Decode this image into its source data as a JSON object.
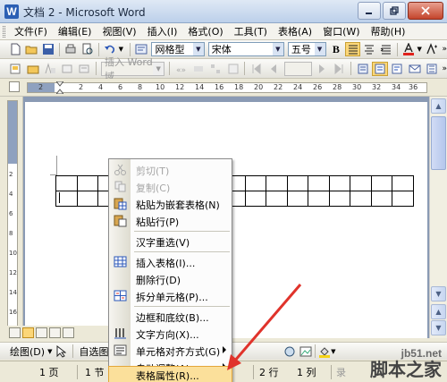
{
  "window": {
    "title": "文档 2 - Microsoft Word",
    "app_icon": "W"
  },
  "menu": [
    "文件(F)",
    "编辑(E)",
    "视图(V)",
    "插入(I)",
    "格式(O)",
    "工具(T)",
    "表格(A)",
    "窗口(W)",
    "帮助(H)"
  ],
  "toolbar": {
    "style_value": "网格型",
    "font_value": "宋体",
    "size_value": "五号",
    "bold_label": "B",
    "insert_word_label": "插入 Word 域"
  },
  "ruler": {
    "numbers": [
      "2",
      "2",
      "4",
      "6",
      "8",
      "10",
      "12",
      "14",
      "16",
      "18",
      "20",
      "22",
      "24",
      "26",
      "28",
      "30",
      "32",
      "34",
      "36",
      "38"
    ],
    "vertical_numbers": [
      "2",
      "4",
      "6",
      "8",
      "10",
      "12",
      "14",
      "16",
      "18",
      "20"
    ]
  },
  "context_menu": {
    "items": [
      {
        "label": "剪切(T)",
        "disabled": true,
        "icon": "scissors-icon"
      },
      {
        "label": "复制(C)",
        "disabled": true,
        "icon": "copy-icon"
      },
      {
        "label": "粘贴为嵌套表格(N)",
        "disabled": false,
        "icon": "paste-nested-icon"
      },
      {
        "label": "粘贴行(P)",
        "disabled": false,
        "icon": "paste-icon"
      },
      {
        "label": "汉字重选(V)",
        "disabled": false,
        "icon": ""
      },
      {
        "label": "插入表格(I)...",
        "disabled": false,
        "icon": "insert-table-icon"
      },
      {
        "label": "删除行(D)",
        "disabled": false,
        "icon": ""
      },
      {
        "label": "拆分单元格(P)...",
        "disabled": false,
        "icon": "split-cells-icon"
      },
      {
        "label": "边框和底纹(B)...",
        "disabled": false,
        "icon": ""
      },
      {
        "label": "文字方向(X)...",
        "disabled": false,
        "icon": "text-direction-icon"
      },
      {
        "label": "单元格对齐方式(G)",
        "disabled": false,
        "icon": "cell-align-icon",
        "submenu": true
      },
      {
        "label": "自动调整(A)",
        "disabled": false,
        "icon": "",
        "submenu": true
      },
      {
        "label": "表格属性(R)...",
        "disabled": false,
        "icon": "",
        "highlighted": true
      }
    ]
  },
  "drawing_toolbar": {
    "draw_label": "绘图(D)",
    "autoshapes_label": "自选图形(U)"
  },
  "status": {
    "page": "1 页",
    "section": "1 节",
    "line": "2 行",
    "col": "1 列",
    "rec": "录"
  },
  "watermark": {
    "site": "jb51.net",
    "name": "脚本之家"
  },
  "colors": {
    "highlight": "#fbe09b",
    "arrow": "#e0332b",
    "title_bar": "#bcd0ea"
  }
}
